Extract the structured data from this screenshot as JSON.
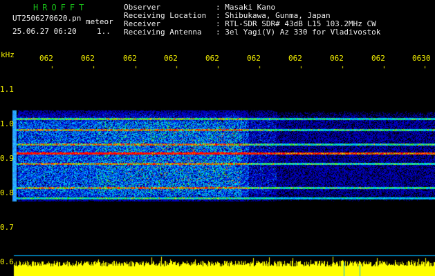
{
  "header": {
    "brand": "HROFFT",
    "filename": "UT2506270620.pn",
    "filename_suffix": "meteor",
    "datetime": "25.06.27 06:20",
    "counter": "1..",
    "info_labels": [
      "Observer",
      "Receiving Location",
      "Receiver",
      "Receiving Antenna"
    ],
    "info_values": [
      ": Masaki Kano",
      ": Shibukawa, Gunma, Japan",
      ": RTL-SDR SDR# 43dB L15 103.2MHz CW",
      ": 3el Yagi(V) Az 330 for Vladivostok"
    ]
  },
  "axes": {
    "freq_unit": "kHz",
    "freq_ticks": [
      "1.1",
      "1.0",
      "0.9",
      "0.8",
      "0.7",
      "0.6"
    ],
    "time_ticks": [
      "062",
      "062",
      "062",
      "062",
      "062",
      "062",
      "062",
      "062",
      "062",
      "0630"
    ]
  },
  "colors": {
    "background": "#000000",
    "label_text": "#f4f000",
    "info_text": "#f0f0f0",
    "brand": "#18c018",
    "spectrum_bar": "#ffff00",
    "cyan_line": "#00b4ff"
  }
}
